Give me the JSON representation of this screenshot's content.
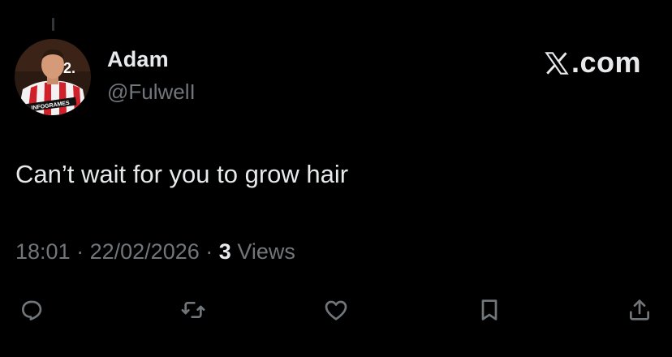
{
  "author": {
    "display_name": "Adam",
    "handle": "@FulwelI",
    "avatar_badge": "2.",
    "avatar_shirt_text": "INFOGRAMES"
  },
  "brand": {
    "label": ".com",
    "icon": "x-logo-icon"
  },
  "tweet": {
    "text": "Can’t wait for you to grow hair"
  },
  "meta": {
    "time": "18:01",
    "separator": "·",
    "date": "22/02/2026",
    "view_count": "3",
    "views_label": "Views"
  },
  "actions": [
    {
      "icon": "reply-icon"
    },
    {
      "icon": "retweet-icon"
    },
    {
      "icon": "like-icon"
    },
    {
      "icon": "bookmark-icon"
    },
    {
      "icon": "share-icon"
    }
  ],
  "colors": {
    "background": "#000000",
    "primary_text": "#e7e9ea",
    "secondary_text": "#71767b",
    "thread_line": "#333639"
  }
}
